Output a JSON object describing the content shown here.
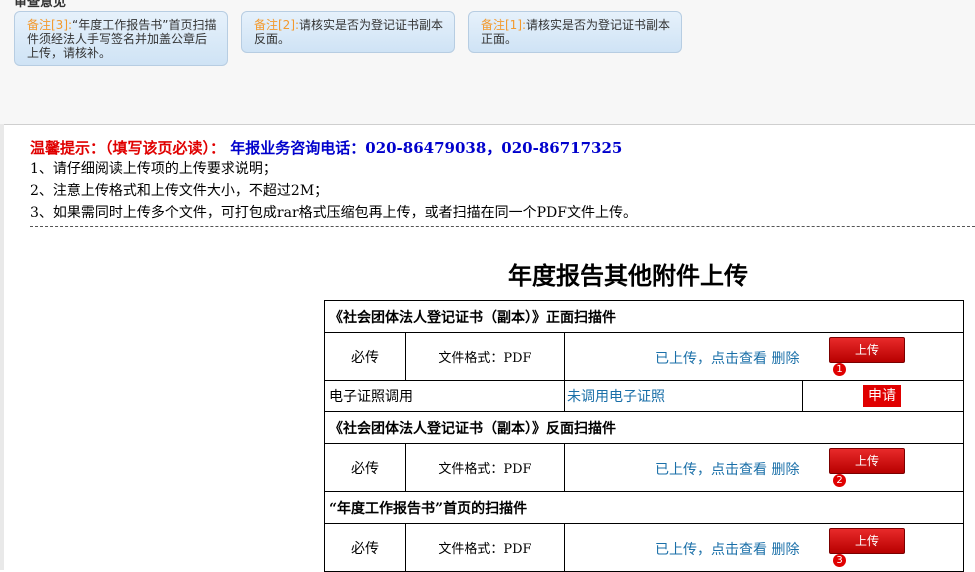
{
  "notes_panel": {
    "cut_title": "审查意见",
    "cards": [
      {
        "tag": "备注[3]:",
        "text": "“年度工作报告书”首页扫描件须经法人手写签名并加盖公章后上传，请核补。"
      },
      {
        "tag": "备注[2]:",
        "text": "请核实是否为登记证书副本反面。"
      },
      {
        "tag": "备注[1]:",
        "text": "请核实是否为登记证书副本正面。"
      }
    ]
  },
  "tips": {
    "label": "温馨提示：（填写该页必读）：",
    "hotline": "年报业务咨询电话：020-86479038，020-86717325",
    "lines": [
      "1、请仔细阅读上传项的上传要求说明；",
      "2、注意上传格式和上传文件大小，不超过2M；",
      "3、如果需同时上传多个文件，可打包成rar格式压缩包再上传，或者扫描在同一个PDF文件上传。"
    ]
  },
  "page_title": "年度报告其他附件上传",
  "sections": [
    {
      "title": "《社会团体法人登记证书（副本）》正面扫描件",
      "required": "必传",
      "format": "文件格式：PDF",
      "status": "已上传，点击查看",
      "delete": "删除",
      "upload": "上传",
      "badge": "1"
    },
    {
      "title": "《社会团体法人登记证书（副本）》反面扫描件",
      "required": "必传",
      "format": "文件格式：PDF",
      "status": "已上传，点击查看",
      "delete": "删除",
      "upload": "上传",
      "badge": "2"
    },
    {
      "title": "“年度工作报告书”首页的扫描件",
      "required": "必传",
      "format": "文件格式：PDF",
      "status": "已上传，点击查看",
      "delete": "删除",
      "upload": "上传",
      "badge": "3"
    }
  ],
  "cert_row": {
    "label": "电子证照调用",
    "status": "未调用电子证照",
    "apply": "申请"
  }
}
